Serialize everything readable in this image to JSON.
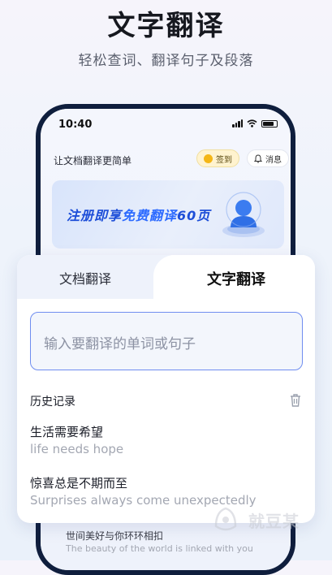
{
  "promo": {
    "title": "文字翻译",
    "subtitle": "轻松查词、翻译句子及段落"
  },
  "status_bar": {
    "time": "10:40"
  },
  "app": {
    "title": "让文档翻译更简单",
    "checkin_label": "签到",
    "message_label": "消息"
  },
  "banner": {
    "text_pre": "注册即享",
    "text_highlight": "免费翻译",
    "text_post": "60页"
  },
  "tabs": [
    {
      "label": "文档翻译",
      "active": false
    },
    {
      "label": "文字翻译",
      "active": true
    }
  ],
  "input": {
    "placeholder": "输入要翻译的单词或句子"
  },
  "history": {
    "title": "历史记录",
    "items": [
      {
        "source": "生活需要希望",
        "translation": "life needs hope"
      },
      {
        "source": "惊喜总是不期而至",
        "translation": "Surprises always come unexpectedly"
      },
      {
        "source": "世间美好与你环环相扣",
        "translation": "The beauty of the world is linked with you"
      }
    ]
  },
  "watermark": {
    "text": "就豆某"
  },
  "colors": {
    "accent": "#2d6bff",
    "frame": "#0f1e3d",
    "input_border": "#6f8df0"
  }
}
